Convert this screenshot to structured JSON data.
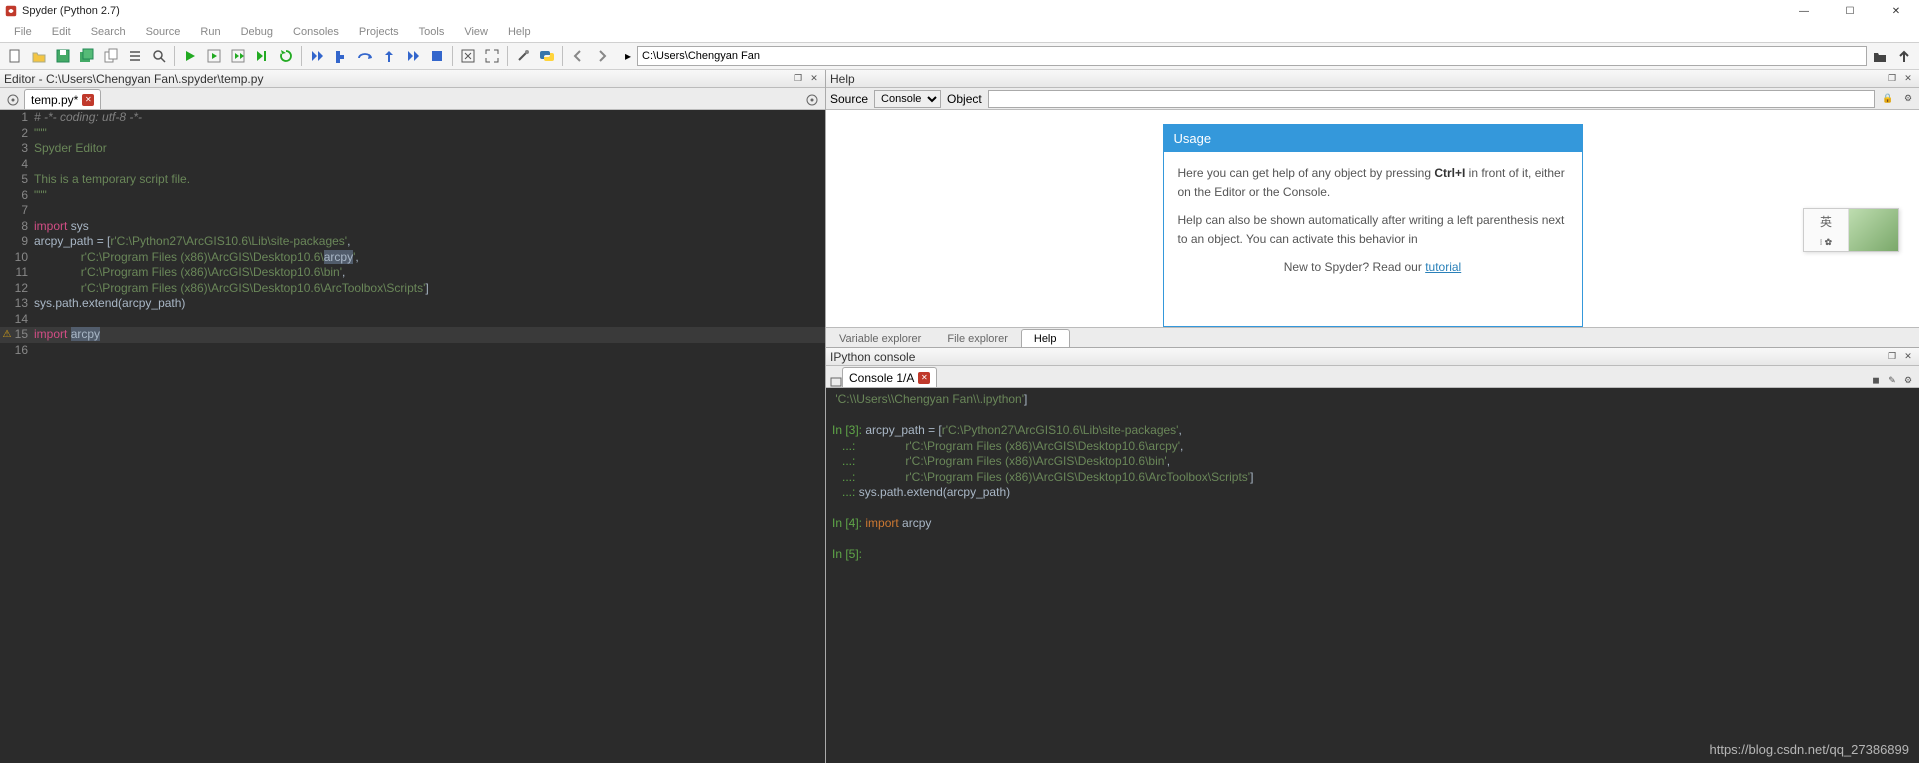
{
  "window": {
    "title": "Spyder (Python 2.7)"
  },
  "menu": [
    "File",
    "Edit",
    "Search",
    "Source",
    "Run",
    "Debug",
    "Consoles",
    "Projects",
    "Tools",
    "View",
    "Help"
  ],
  "path_field": "C:\\Users\\Chengyan Fan",
  "editor_pane_title": "Editor - C:\\Users\\Chengyan Fan\\.spyder\\temp.py",
  "editor_tab": "temp.py*",
  "code_lines": [
    {
      "n": 1,
      "html": "<span class='hl-comment'># -*- coding: utf-8 -*-</span>"
    },
    {
      "n": 2,
      "html": "<span class='hl-str'>\"\"\"</span>"
    },
    {
      "n": 3,
      "html": "<span class='hl-str'>Spyder Editor</span>"
    },
    {
      "n": 4,
      "html": ""
    },
    {
      "n": 5,
      "html": "<span class='hl-str'>This is a temporary script file.</span>"
    },
    {
      "n": 6,
      "html": "<span class='hl-str'>\"\"\"</span>"
    },
    {
      "n": 7,
      "html": ""
    },
    {
      "n": 8,
      "html": "<span class='hl-kw2'>import</span> <span class='hl-id'>sys</span>"
    },
    {
      "n": 9,
      "html": "<span class='hl-id'>arcpy_path</span> = [<span class='hl-str'>r'C:\\Python27\\ArcGIS10.6\\Lib\\site-packages'</span>,"
    },
    {
      "n": 10,
      "html": "              <span class='hl-str'>r'C:\\Program Files (x86)\\ArcGIS\\Desktop10.6\\</span><span class='hl-sel'>arcpy</span><span class='hl-str'>'</span>,"
    },
    {
      "n": 11,
      "html": "              <span class='hl-str'>r'C:\\Program Files (x86)\\ArcGIS\\Desktop10.6\\bin'</span>,"
    },
    {
      "n": 12,
      "html": "              <span class='hl-str'>r'C:\\Program Files (x86)\\ArcGIS\\Desktop10.6\\ArcToolbox\\Scripts'</span>]"
    },
    {
      "n": 13,
      "html": "<span class='hl-id'>sys.path.extend(arcpy_path)</span>"
    },
    {
      "n": 14,
      "html": ""
    },
    {
      "n": 15,
      "html": "<span class='hl-kw2'>import</span> <span class='hl-sel'>arcpy</span>",
      "warn": true,
      "current": true
    },
    {
      "n": 16,
      "html": ""
    }
  ],
  "help": {
    "pane_title": "Help",
    "source_label": "Source",
    "source_value": "Console",
    "object_label": "Object",
    "object_value": "",
    "usage_title": "Usage",
    "usage_p1_a": "Here you can get help of any object by pressing ",
    "usage_p1_key": "Ctrl+I",
    "usage_p1_b": " in front of it, either on the Editor or the Console.",
    "usage_p2": "Help can also be shown automatically after writing a left parenthesis next to an object. You can activate this behavior in ",
    "usage_p3_a": "New to Spyder? Read our ",
    "usage_p3_link": "tutorial"
  },
  "ime": {
    "label": "英",
    "dots": "፧ ✿"
  },
  "bottom_tabs": {
    "tab1": "Variable explorer",
    "tab2": "File explorer",
    "tab3": "Help"
  },
  "console_pane_title": "IPython console",
  "console_tab": "Console 1/A",
  "console_lines": [
    {
      "html": " <span class='c-str'>'C:\\\\Users\\\\Chengyan Fan\\\\.ipython'</span>]"
    },
    {
      "html": ""
    },
    {
      "html": "<span class='c-in'>In [3]:</span> arcpy_path = [<span class='c-str'>r'C:\\Python27\\ArcGIS10.6\\Lib\\site-packages'</span>,"
    },
    {
      "html": "   <span class='c-in'>...:</span>               <span class='c-str'>r'C:\\Program Files (x86)\\ArcGIS\\Desktop10.6\\arcpy'</span>,"
    },
    {
      "html": "   <span class='c-in'>...:</span>               <span class='c-str'>r'C:\\Program Files (x86)\\ArcGIS\\Desktop10.6\\bin'</span>,"
    },
    {
      "html": "   <span class='c-in'>...:</span>               <span class='c-str'>r'C:\\Program Files (x86)\\ArcGIS\\Desktop10.6\\ArcToolbox\\Scripts'</span>]"
    },
    {
      "html": "   <span class='c-in'>...:</span> sys.path.extend(arcpy_path)"
    },
    {
      "html": ""
    },
    {
      "html": "<span class='c-in'>In [4]:</span> <span class='c-kw'>import</span> arcpy"
    },
    {
      "html": ""
    },
    {
      "html": "<span class='c-in'>In [5]:</span> "
    }
  ],
  "watermark": "https://blog.csdn.net/qq_27386899"
}
